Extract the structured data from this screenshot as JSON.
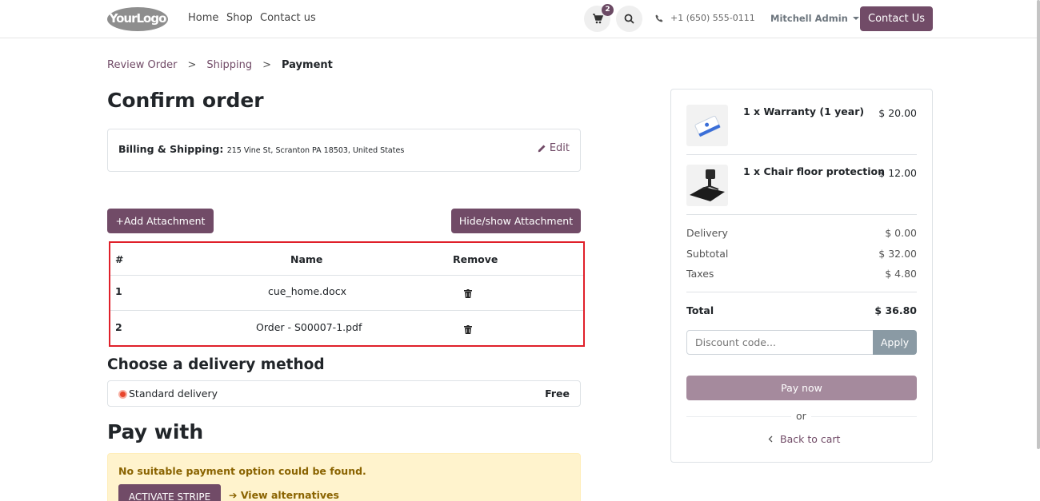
{
  "header": {
    "logo_text": "YourLogo",
    "nav": [
      "Home",
      "Shop",
      "Contact us"
    ],
    "cart_count": "2",
    "phone": "+1 (650) 555-0111",
    "user_name": "Mitchell Admin",
    "contact_button": "Contact Us"
  },
  "breadcrumb": {
    "items": [
      "Review Order",
      "Shipping",
      "Payment"
    ],
    "separator": ">"
  },
  "main": {
    "title": "Confirm order",
    "billing": {
      "label": "Billing & Shipping:",
      "address": "215 Vine St, Scranton PA 18503, United States",
      "edit_label": "Edit"
    },
    "add_attachment_label": "+Add Attachment",
    "hide_show_label": "Hide/show Attachment",
    "attachments": {
      "columns": [
        "#",
        "Name",
        "Remove"
      ],
      "rows": [
        {
          "num": "1",
          "name": "cue_home.docx"
        },
        {
          "num": "2",
          "name": "Order - S00007-1.pdf"
        }
      ]
    },
    "delivery": {
      "heading": "Choose a delivery method",
      "option_name": "Standard delivery",
      "option_price": "Free"
    },
    "payment": {
      "heading": "Pay with",
      "alert": "No suitable payment option could be found.",
      "activate_button": "ACTIVATE STRIPE",
      "alternatives_link": "➔ View alternatives"
    }
  },
  "summary": {
    "products": [
      {
        "qty_name": "1 x Warranty (1 year)",
        "price": "$ 20.00"
      },
      {
        "qty_name": "1 x Chair floor protection",
        "price": "$ 12.00"
      }
    ],
    "delivery_label": "Delivery",
    "delivery_value": "$ 0.00",
    "subtotal_label": "Subtotal",
    "subtotal_value": "$ 32.00",
    "taxes_label": "Taxes",
    "taxes_value": "$ 4.80",
    "total_label": "Total",
    "total_value": "$ 36.80",
    "discount_placeholder": "Discount code...",
    "apply_label": "Apply",
    "pay_now_label": "Pay now",
    "or_label": "or",
    "back_label": "Back to cart"
  },
  "colors": {
    "brand": "#714b67",
    "highlight_border": "#e0202a",
    "alert_bg": "#fff3cd",
    "radio": "#e8452c"
  }
}
